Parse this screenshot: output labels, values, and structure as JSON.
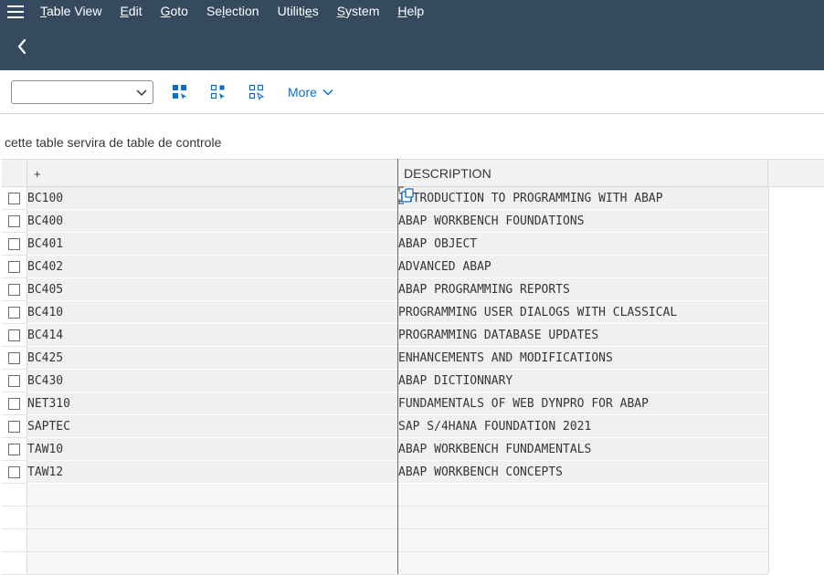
{
  "menubar": {
    "items": [
      {
        "pre": "",
        "key": "T",
        "post": "able View"
      },
      {
        "pre": "",
        "key": "E",
        "post": "dit"
      },
      {
        "pre": "",
        "key": "G",
        "post": "oto"
      },
      {
        "pre": "Se",
        "key": "l",
        "post": "ection"
      },
      {
        "pre": "Utiliti",
        "key": "e",
        "post": "s"
      },
      {
        "pre": "",
        "key": "S",
        "post": "ystem"
      },
      {
        "pre": "",
        "key": "H",
        "post": "elp"
      }
    ]
  },
  "toolbar": {
    "combo_value": "",
    "more_label": "More"
  },
  "table": {
    "title": "cette table servira de table de controle",
    "col1_header": "+",
    "col2_header": "DESCRIPTION",
    "rows": [
      {
        "code": "BC100",
        "desc": "INTRODUCTION TO PROGRAMMING WITH ABAP"
      },
      {
        "code": "BC400",
        "desc": "ABAP WORKBENCH FOUNDATIONS"
      },
      {
        "code": "BC401",
        "desc": "ABAP OBJECT"
      },
      {
        "code": "BC402",
        "desc": "ADVANCED ABAP"
      },
      {
        "code": "BC405",
        "desc": "ABAP PROGRAMMING REPORTS"
      },
      {
        "code": "BC410",
        "desc": "PROGRAMMING USER DIALOGS WITH CLASSICAL"
      },
      {
        "code": "BC414",
        "desc": "PROGRAMMING DATABASE UPDATES"
      },
      {
        "code": "BC425",
        "desc": "ENHANCEMENTS AND MODIFICATIONS"
      },
      {
        "code": "BC430",
        "desc": "ABAP DICTIONNARY"
      },
      {
        "code": "NET310",
        "desc": "FUNDAMENTALS OF WEB DYNPRO FOR ABAP"
      },
      {
        "code": "SAPTEC",
        "desc": "SAP S/4HANA FOUNDATION 2021"
      },
      {
        "code": "TAW10",
        "desc": "ABAP WORKBENCH FUNDAMENTALS"
      },
      {
        "code": "TAW12",
        "desc": "ABAP WORKBENCH CONCEPTS"
      }
    ],
    "empty_rows": 4
  },
  "colors": {
    "shell": "#354a5f",
    "accent": "#0a6ed1",
    "text": "#32363a"
  }
}
